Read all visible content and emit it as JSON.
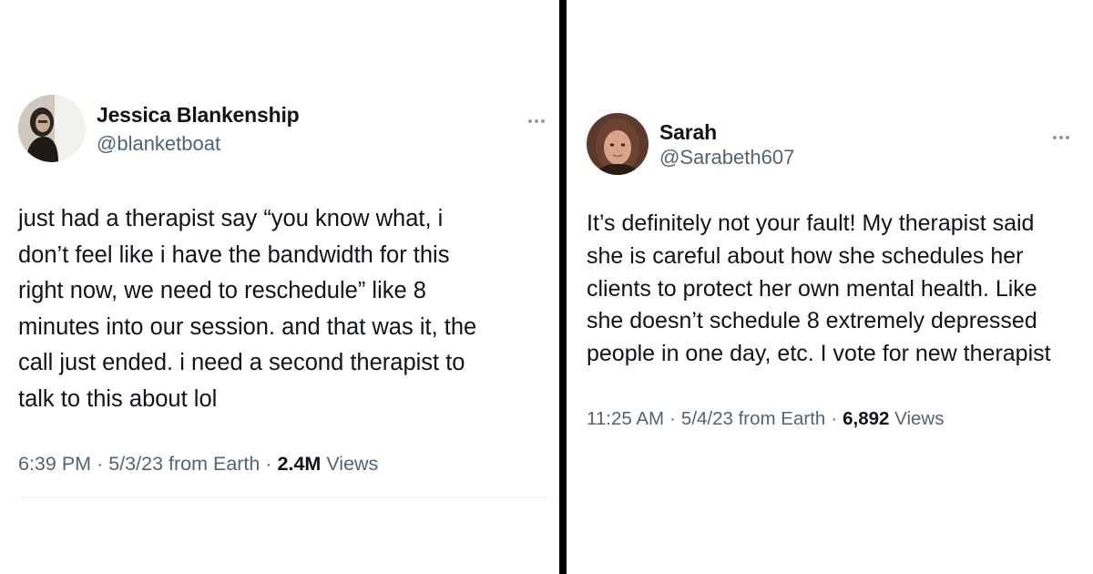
{
  "tweets": [
    {
      "display_name": "Jessica Blankenship",
      "handle": "@blanketboat",
      "text": "just had a therapist say “you know what, i\ndon’t feel like i have the bandwidth for this\nright now, we need to reschedule” like 8\nminutes into our session. and that was it, the\ncall just ended. i need a second therapist to\ntalk to this about lol",
      "time": "6:39 PM",
      "date_source": "5/3/23 from Earth",
      "views_count": "2.4M",
      "views_label": "Views",
      "separator": "·",
      "avatar_icon": "profile-photo-icon",
      "more_icon": "more-options-icon"
    },
    {
      "display_name": "Sarah",
      "handle": "@Sarabeth607",
      "text": "It’s definitely not your fault! My therapist said\nshe is careful about how she schedules her\nclients to protect her own mental health. Like\nshe doesn’t schedule 8 extremely depressed\npeople in one day, etc. I vote for new therapist",
      "time": "11:25 AM",
      "date_source": "5/4/23 from Earth",
      "views_count": "6,892",
      "views_label": "Views",
      "separator": "·",
      "avatar_icon": "profile-photo-icon",
      "more_icon": "more-options-icon"
    }
  ],
  "colors": {
    "text_primary": "#0f1419",
    "text_secondary": "#536471",
    "divider": "#000000",
    "more_dots": "#8b98a5"
  }
}
